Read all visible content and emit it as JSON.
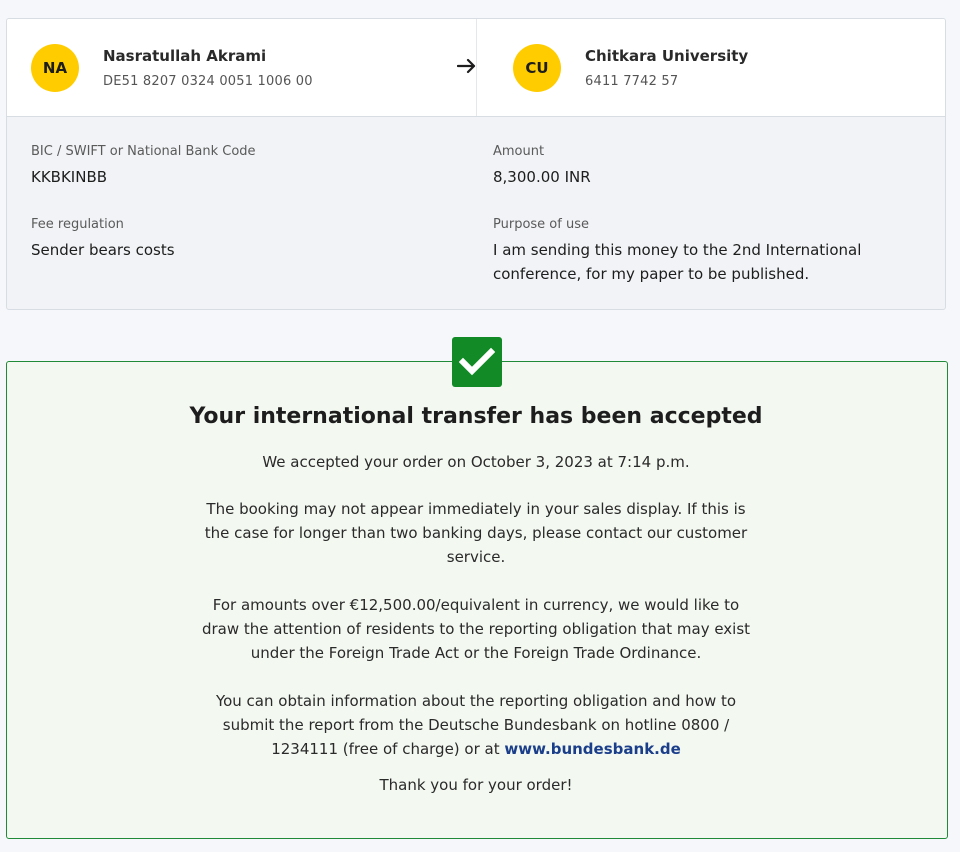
{
  "sender": {
    "initials": "NA",
    "name": "Nasratullah Akrami",
    "account": "DE51 8207 0324 0051 1006 00"
  },
  "arrow_icon": "arrow-right-icon",
  "recipient": {
    "initials": "CU",
    "name": "Chitkara University",
    "account": "6411 7742 57"
  },
  "details": {
    "bic_label": "BIC / SWIFT or National Bank Code",
    "bic_value": "KKBKINBB",
    "amount_label": "Amount",
    "amount_value": "8,300.00 INR",
    "fee_label": "Fee regulation",
    "fee_value": "Sender bears costs",
    "purpose_label": "Purpose of use",
    "purpose_value": "I am sending this money to the 2nd International conference, for my paper to be published."
  },
  "confirmation": {
    "icon": "checkmark-icon",
    "title": "Your international transfer has been accepted",
    "accepted_text": "We accepted your order on October 3, 2023 at 7:14 p.m.",
    "booking_text": "The booking may not appear immediately in your sales display. If this is the case for longer than two banking days, please contact our customer service.",
    "reporting_text": "For amounts over €12,500.00/equivalent in currency, we would like to draw the attention of residents to the reporting obligation that may exist under the Foreign Trade Act or the Foreign Trade Ordinance.",
    "info_text": "You can obtain information about the reporting obligation and how to submit the report from the Deutsche Bundesbank on hotline 0800 / 1234111 (free of charge) or at",
    "link_text": "www.bundesbank.de",
    "thanks_text": "Thank you for your order!"
  },
  "colors": {
    "avatar": "#ffcc00",
    "success_border": "#1f8a38",
    "check_bg": "#128a26",
    "link": "#1a3e8a"
  }
}
